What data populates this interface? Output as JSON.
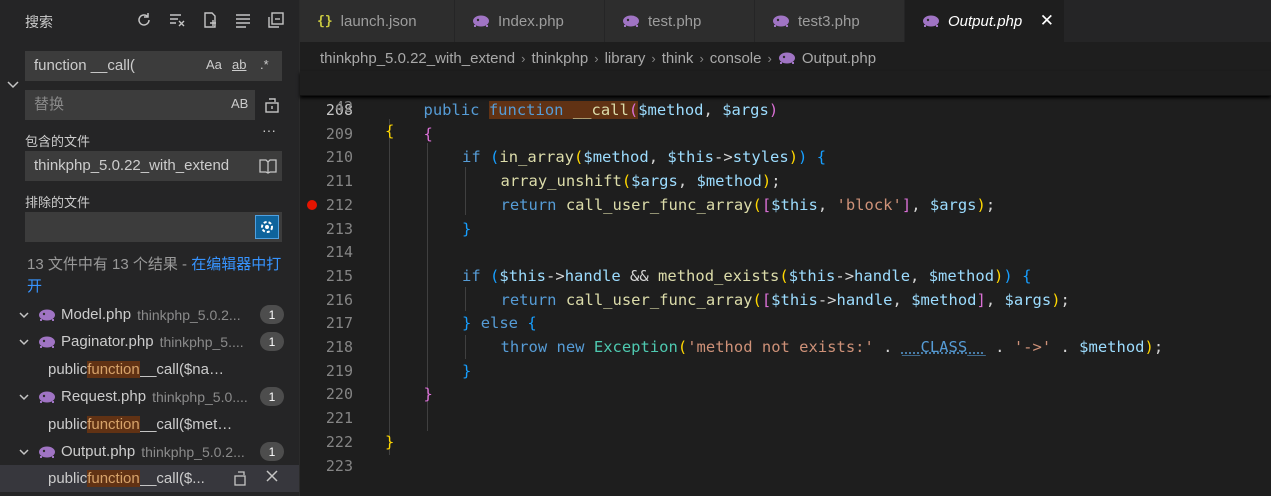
{
  "sidebar": {
    "title": "搜索",
    "search_value": "function __call(",
    "opt_case": "Aa",
    "opt_word": "ab",
    "opt_regex": ".*",
    "replace_placeholder": "替换",
    "replace_opt": "AB",
    "more": "···",
    "include_label": "包含的文件",
    "include_value": "thinkphp_5.0.22_with_extend",
    "exclude_label": "排除的文件",
    "exclude_value": "",
    "results_prefix": "13 文件中有 13 个结果 - ",
    "results_link": "在编辑器中打开"
  },
  "tree": [
    {
      "kind": "file",
      "name": "Model.php",
      "path": "thinkphp_5.0.2...",
      "count": "1"
    },
    {
      "kind": "file",
      "name": "Paginator.php",
      "path": "thinkphp_5....",
      "count": "1"
    },
    {
      "kind": "match",
      "pre": "public ",
      "match": "function",
      "post": " __call($name, $ar..."
    },
    {
      "kind": "file",
      "name": "Request.php",
      "path": "thinkphp_5.0....",
      "count": "1"
    },
    {
      "kind": "match",
      "pre": "public ",
      "match": "function",
      "post": " __call($method, $..."
    },
    {
      "kind": "file",
      "name": "Output.php",
      "path": "thinkphp_5.0.2...",
      "count": "1"
    },
    {
      "kind": "match",
      "pre": "public ",
      "match": "function",
      "post": " __call($...",
      "selected": true
    }
  ],
  "tabs": [
    {
      "label": "launch.json",
      "icon": "json-icon"
    },
    {
      "label": "Index.php",
      "icon": "php-icon"
    },
    {
      "label": "test.php",
      "icon": "php-icon"
    },
    {
      "label": "test3.php",
      "icon": "php-icon"
    },
    {
      "label": "Output.php",
      "icon": "php-icon",
      "active": true
    }
  ],
  "breadcrumbs": [
    "thinkphp_5.0.22_with_extend",
    "thinkphp",
    "library",
    "think",
    "console",
    "Output.php"
  ],
  "code": {
    "sticky_line": {
      "num": "42",
      "text": "{"
    },
    "lines": [
      {
        "num": "208"
      },
      {
        "num": "209"
      },
      {
        "num": "210"
      },
      {
        "num": "211"
      },
      {
        "num": "212",
        "breakpoint": true
      },
      {
        "num": "213"
      },
      {
        "num": "214"
      },
      {
        "num": "215"
      },
      {
        "num": "216"
      },
      {
        "num": "217"
      },
      {
        "num": "218"
      },
      {
        "num": "219"
      },
      {
        "num": "220"
      },
      {
        "num": "221"
      },
      {
        "num": "222"
      },
      {
        "num": "223"
      }
    ],
    "text": {
      "l208_public": "public",
      "l208_function": "function",
      "l208_call": "__call",
      "l208_method": "$method",
      "l208_args": "$args",
      "l210_if": "if",
      "l210_in_array": "in_array",
      "l210_method": "$method",
      "l210_this": "$this",
      "l210_styles": "styles",
      "l211_fn": "array_unshift",
      "l211_args": "$args",
      "l211_method": "$method",
      "l212_return": "return",
      "l212_fn": "call_user_func_array",
      "l212_this": "$this",
      "l212_block": "'block'",
      "l212_args": "$args",
      "l215_if": "if",
      "l215_this": "$this",
      "l215_handle": "handle",
      "l215_me": "method_exists",
      "l215_this2": "$this",
      "l215_handle2": "handle",
      "l215_method": "$method",
      "l216_return": "return",
      "l216_fn": "call_user_func_array",
      "l216_this": "$this",
      "l216_handle": "handle",
      "l216_method": "$method",
      "l216_args": "$args",
      "l217_else": "else",
      "l218_throw": "throw",
      "l218_new": "new",
      "l218_exc": "Exception",
      "l218_str1": "'method not exists:'",
      "l218_class": "__CLASS__",
      "l218_str2": "'->'",
      "l218_method": "$method"
    }
  }
}
